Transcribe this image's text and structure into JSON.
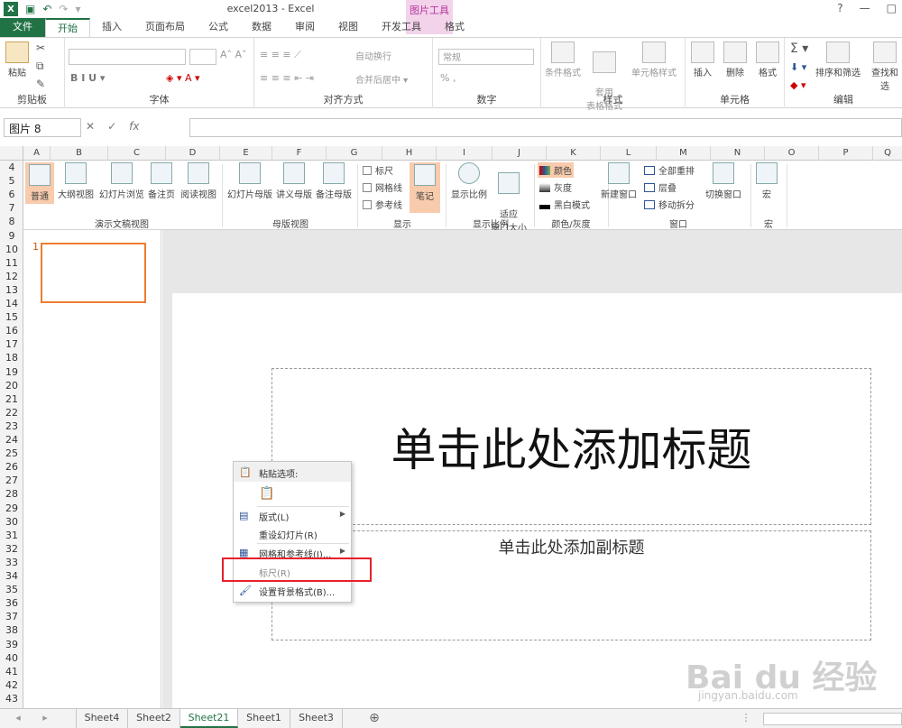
{
  "title_bar": {
    "title": "excel2013 - Excel",
    "context_group": "图片工具",
    "help": "?",
    "minimize": "—",
    "restore": "□"
  },
  "tabs": [
    "文件",
    "开始",
    "插入",
    "页面布局",
    "公式",
    "数据",
    "审阅",
    "视图",
    "开发工具",
    "格式"
  ],
  "home_ribbon": {
    "paste": "粘贴",
    "clipboard": "剪贴板",
    "font_group": "字体",
    "font_buttons": "B I U ▾",
    "align_group": "对齐方式",
    "wrap": "自动换行",
    "merge": "合并后居中 ▾",
    "number_format": "常规",
    "percent": "% ,",
    "number_group": "数字",
    "cond_fmt": "条件格式",
    "table_fmt": "套用\n表格格式",
    "cell_style": "单元格样式",
    "styles_group": "样式",
    "insert": "插入",
    "delete": "删除",
    "format": "格式",
    "cells_group": "单元格",
    "sort": "排序和筛选",
    "find": "查找和选",
    "edit_group": "编辑"
  },
  "formula_bar": {
    "name_box": "图片 8",
    "cancel": "✕",
    "enter": "✓",
    "fx": "fx"
  },
  "columns": [
    "A",
    "B",
    "C",
    "D",
    "E",
    "F",
    "G",
    "H",
    "I",
    "J",
    "K",
    "L",
    "M",
    "N",
    "O",
    "P",
    "Q"
  ],
  "rows": [
    "4",
    "5",
    "6",
    "7",
    "8",
    "9",
    "10",
    "11",
    "12",
    "13",
    "14",
    "15",
    "16",
    "17",
    "18",
    "19",
    "20",
    "21",
    "22",
    "23",
    "24",
    "25",
    "26",
    "27",
    "28",
    "29",
    "30",
    "31",
    "32",
    "33",
    "34",
    "35",
    "36",
    "37",
    "38",
    "39",
    "40",
    "41",
    "42",
    "43"
  ],
  "view_ribbon": {
    "normal": "普通",
    "outline": "大纲视图",
    "sorter": "幻灯片浏览",
    "notes": "备注页",
    "reading": "阅读视图",
    "group_pres": "演示文稿视图",
    "slide_master": "幻灯片母版",
    "handout_master": "讲义母版",
    "notes_master": "备注母版",
    "group_master": "母版视图",
    "ruler": "标尺",
    "gridlines": "网格线",
    "guides": "参考线",
    "notes_btn": "笔记",
    "group_show": "显示",
    "zoom": "显示比例",
    "fit": "适应\n窗口大小",
    "group_zoom": "显示比例",
    "color": "颜色",
    "gray": "灰度",
    "bw": "黑白模式",
    "group_color": "颜色/灰度",
    "new_window": "新建窗口",
    "arrange_all": "全部重排",
    "cascade": "层叠",
    "move_split": "移动拆分",
    "switch": "切换窗口",
    "group_window": "窗口",
    "macro": "宏",
    "group_macro": "宏"
  },
  "slide_pane": {
    "number": "1"
  },
  "slide": {
    "title": "单击此处添加标题",
    "subtitle": "单击此处添加副标题"
  },
  "context_menu": {
    "paste_options": "粘贴选项:",
    "layout": "版式(L)",
    "reset": "重设幻灯片(R)",
    "grid": "网格和参考线(I)...",
    "ruler": "标尺(R)",
    "bg": "设置背景格式(B)..."
  },
  "sheet_tabs": [
    "Sheet4",
    "Sheet2",
    "Sheet21",
    "Sheet1",
    "Sheet3"
  ],
  "active_sheet": "Sheet21",
  "nav": {
    "prev": "◂",
    "next": "▸",
    "add": "⊕",
    "more": "⋮"
  },
  "watermark": {
    "brand": "Bai du 经验",
    "url": "jingyan.baidu.com"
  }
}
